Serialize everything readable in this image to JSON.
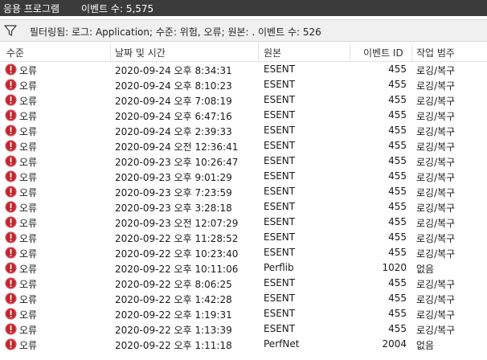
{
  "titlebar": {
    "title": "응용 프로그램",
    "event_count": "이벤트 수: 5,575"
  },
  "filter": {
    "icon": "funnel-icon",
    "text": "필터링됨: 로그: Application; 수준: 위험, 오류; 원본: . 이벤트 수: 526"
  },
  "columns": {
    "level": "수준",
    "datetime": "날짜 및 시간",
    "source": "원본",
    "event_id": "이벤트 ID",
    "category": "작업 범주"
  },
  "colors": {
    "titlebar_bg": "#3b3b3b",
    "error_red": "#c0262d",
    "filter_bg": "#f0f0f0"
  },
  "rows": [
    {
      "level": "오류",
      "datetime": "2020-09-24 오후 8:34:31",
      "source": "ESENT",
      "event_id": "455",
      "category": "로깅/복구"
    },
    {
      "level": "오류",
      "datetime": "2020-09-24 오후 8:10:23",
      "source": "ESENT",
      "event_id": "455",
      "category": "로깅/복구"
    },
    {
      "level": "오류",
      "datetime": "2020-09-24 오후 7:08:19",
      "source": "ESENT",
      "event_id": "455",
      "category": "로깅/복구"
    },
    {
      "level": "오류",
      "datetime": "2020-09-24 오후 6:47:16",
      "source": "ESENT",
      "event_id": "455",
      "category": "로깅/복구"
    },
    {
      "level": "오류",
      "datetime": "2020-09-24 오후 2:39:33",
      "source": "ESENT",
      "event_id": "455",
      "category": "로깅/복구"
    },
    {
      "level": "오류",
      "datetime": "2020-09-24 오전 12:36:41",
      "source": "ESENT",
      "event_id": "455",
      "category": "로깅/복구"
    },
    {
      "level": "오류",
      "datetime": "2020-09-23 오후 10:26:47",
      "source": "ESENT",
      "event_id": "455",
      "category": "로깅/복구"
    },
    {
      "level": "오류",
      "datetime": "2020-09-23 오후 9:01:29",
      "source": "ESENT",
      "event_id": "455",
      "category": "로깅/복구"
    },
    {
      "level": "오류",
      "datetime": "2020-09-23 오후 7:23:59",
      "source": "ESENT",
      "event_id": "455",
      "category": "로깅/복구"
    },
    {
      "level": "오류",
      "datetime": "2020-09-23 오후 3:28:18",
      "source": "ESENT",
      "event_id": "455",
      "category": "로깅/복구"
    },
    {
      "level": "오류",
      "datetime": "2020-09-23 오전 12:07:29",
      "source": "ESENT",
      "event_id": "455",
      "category": "로깅/복구"
    },
    {
      "level": "오류",
      "datetime": "2020-09-22 오후 11:28:52",
      "source": "ESENT",
      "event_id": "455",
      "category": "로깅/복구"
    },
    {
      "level": "오류",
      "datetime": "2020-09-22 오후 10:23:40",
      "source": "ESENT",
      "event_id": "455",
      "category": "로깅/복구"
    },
    {
      "level": "오류",
      "datetime": "2020-09-22 오후 10:11:06",
      "source": "Perflib",
      "event_id": "1020",
      "category": "없음"
    },
    {
      "level": "오류",
      "datetime": "2020-09-22 오후 8:06:25",
      "source": "ESENT",
      "event_id": "455",
      "category": "로깅/복구"
    },
    {
      "level": "오류",
      "datetime": "2020-09-22 오후 1:42:28",
      "source": "ESENT",
      "event_id": "455",
      "category": "로깅/복구"
    },
    {
      "level": "오류",
      "datetime": "2020-09-22 오후 1:19:31",
      "source": "ESENT",
      "event_id": "455",
      "category": "로깅/복구"
    },
    {
      "level": "오류",
      "datetime": "2020-09-22 오후 1:13:39",
      "source": "ESENT",
      "event_id": "455",
      "category": "로깅/복구"
    },
    {
      "level": "오류",
      "datetime": "2020-09-22 오후 1:11:18",
      "source": "PerfNet",
      "event_id": "2004",
      "category": "없음"
    }
  ]
}
